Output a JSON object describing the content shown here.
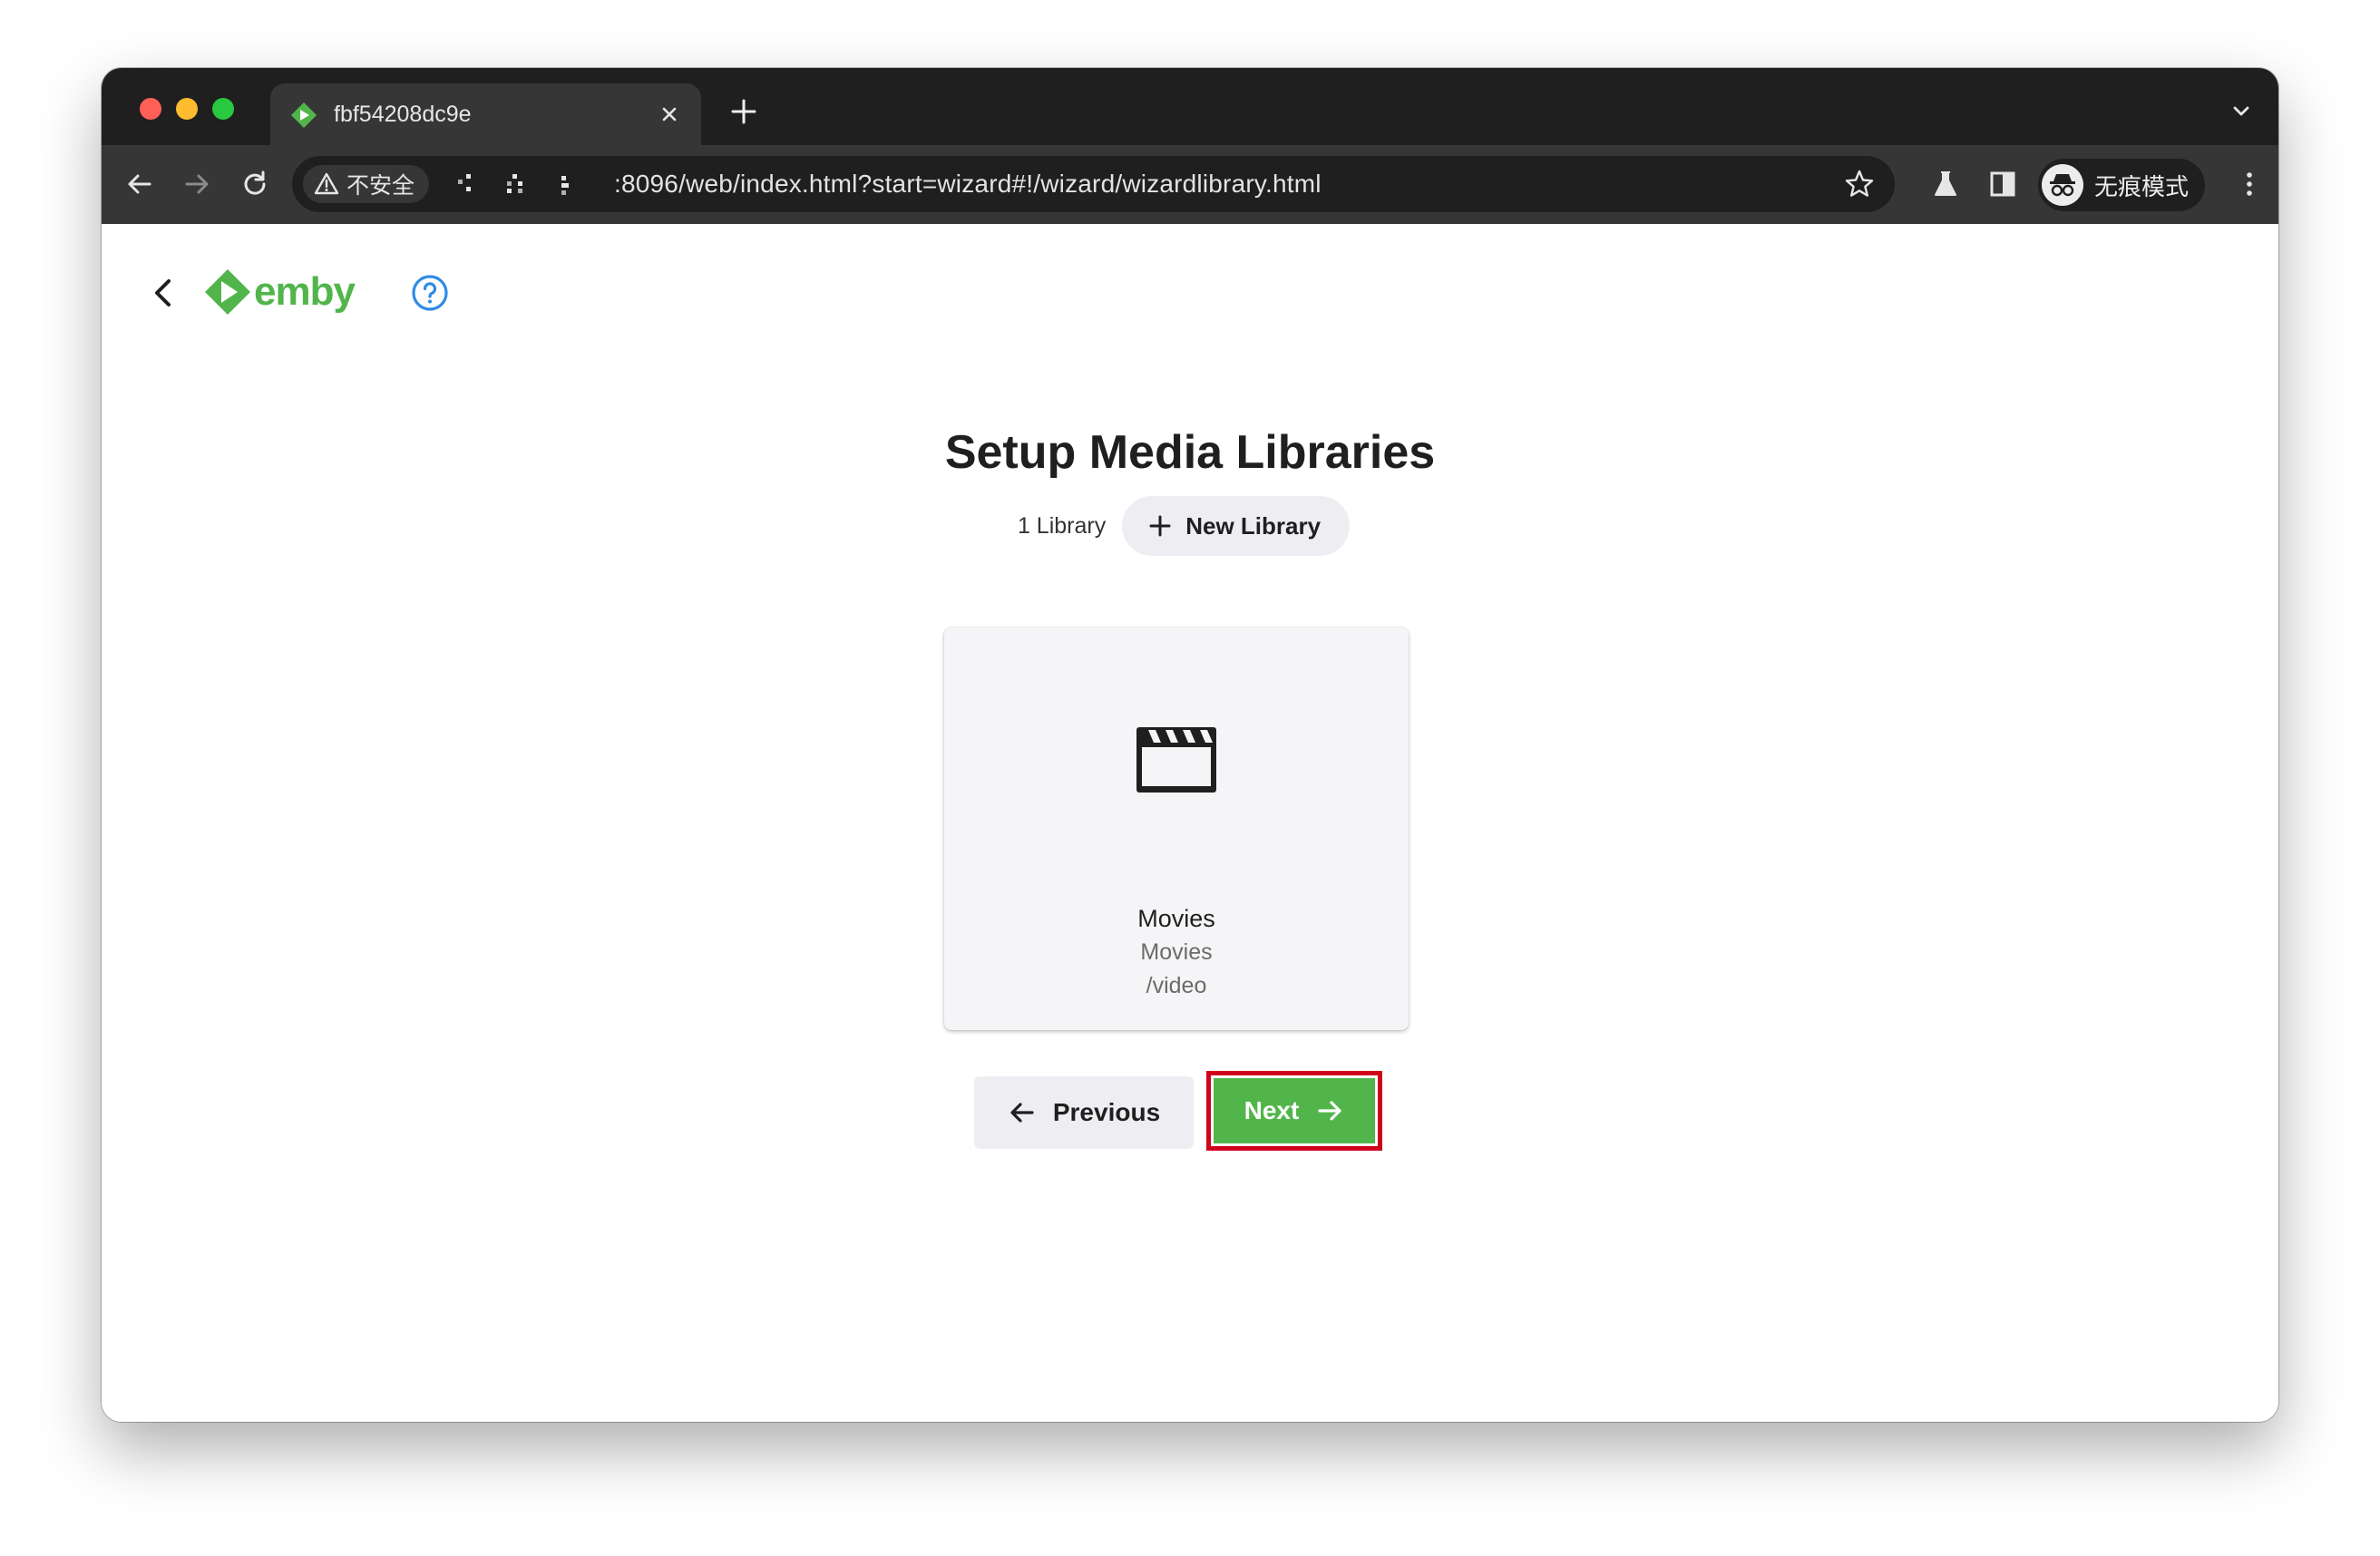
{
  "browser": {
    "tab_title": "fbf54208dc9e",
    "security_label": "不安全",
    "url": ":8096/web/index.html?start=wizard#!/wizard/wizardlibrary.html",
    "incognito_label": "无痕模式"
  },
  "header": {
    "logo_text": "emby"
  },
  "main": {
    "title": "Setup Media Libraries",
    "library_count": "1 Library",
    "new_library_label": "New Library",
    "libraries": [
      {
        "name": "Movies",
        "type": "Movies",
        "path": "/video",
        "icon": "movie-clapperboard-icon"
      }
    ],
    "previous_label": "Previous",
    "next_label": "Next"
  },
  "colors": {
    "brand_green": "#52b54b",
    "highlight_red": "#d0021b",
    "help_blue": "#2e8be6"
  }
}
